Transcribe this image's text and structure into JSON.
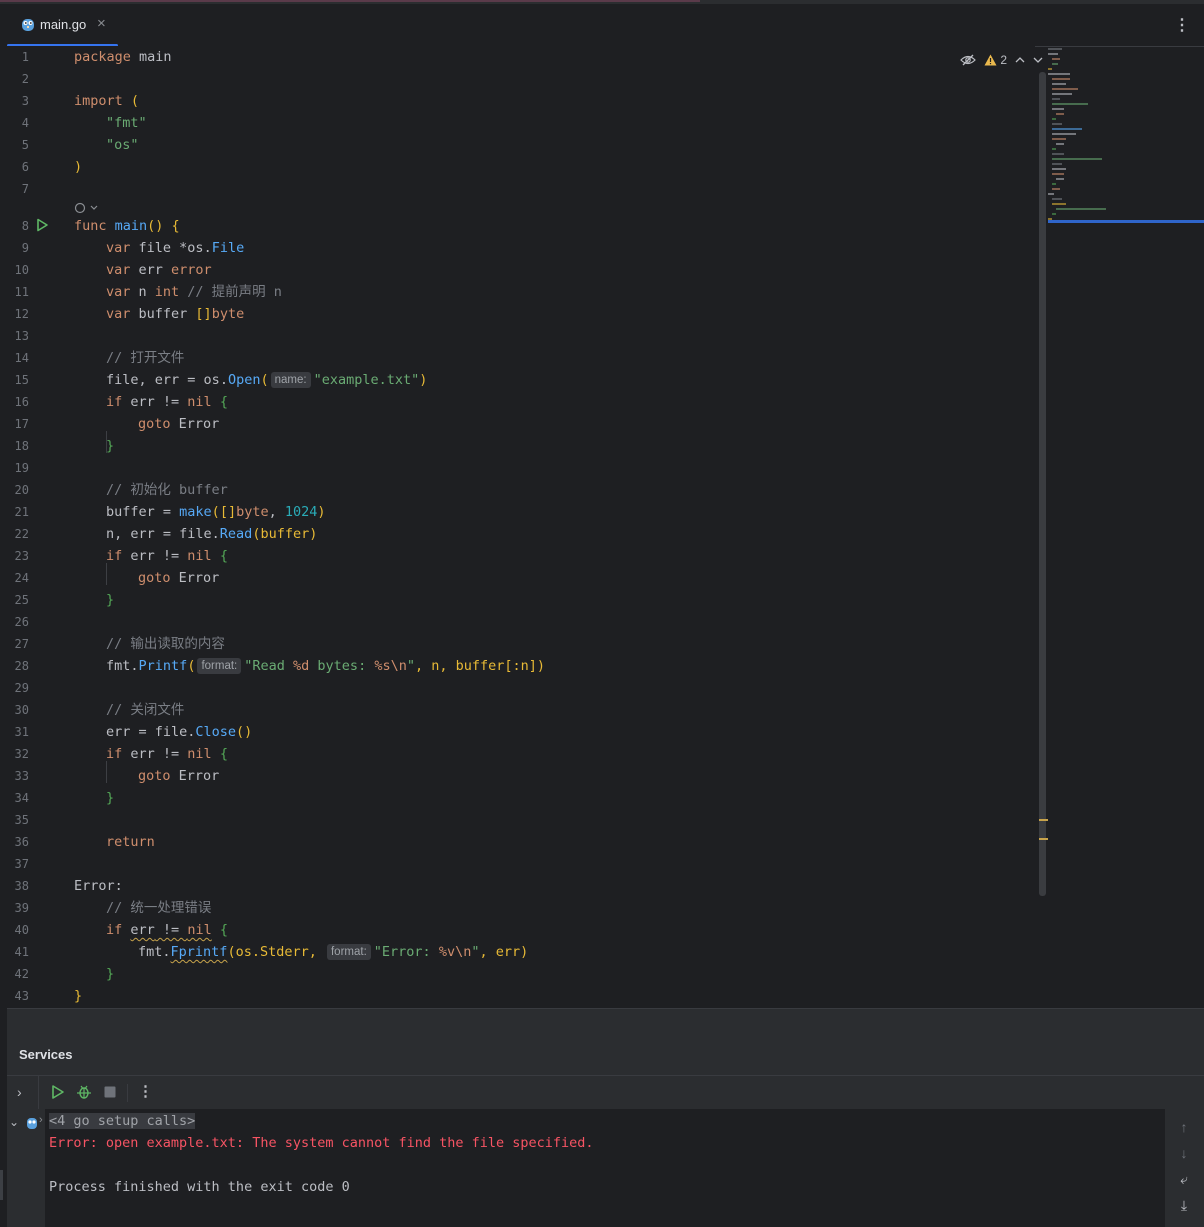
{
  "tab": {
    "file_name": "main.go",
    "close_glyph": "×",
    "menu_glyph": "⋮"
  },
  "inspections": {
    "warning_count": "2"
  },
  "gutter": {
    "line_numbers": [
      "1",
      "2",
      "3",
      "4",
      "5",
      "6",
      "7",
      "8",
      "9",
      "10",
      "11",
      "12",
      "13",
      "14",
      "15",
      "16",
      "17",
      "18",
      "19",
      "20",
      "21",
      "22",
      "23",
      "24",
      "25",
      "26",
      "27",
      "28",
      "29",
      "30",
      "31",
      "32",
      "33",
      "34",
      "35",
      "36",
      "37",
      "38",
      "39",
      "40",
      "41",
      "42",
      "43"
    ]
  },
  "code": {
    "l1_kw": "package",
    "l1_name": " main",
    "l3_kw": "import",
    "l3_paren": " (",
    "l4": "\"fmt\"",
    "l5": "\"os\"",
    "l6": ")",
    "l8_kw": "func",
    "l8_fn": " main",
    "l8_rest": "() {",
    "l9_kw": "var",
    "l9_rest": " file *",
    "l9_pkg": "os",
    "l9_type": "File",
    "l10_kw": "var",
    "l10_name": " err ",
    "l10_type": "error",
    "l11_kw": "var",
    "l11_name": " n ",
    "l11_type": "int",
    "l11_comment": " // 提前声明 n",
    "l12_kw": "var",
    "l12_name": " buffer ",
    "l12_br": "[]",
    "l12_type": "byte",
    "l14": "// 打开文件",
    "l15_a": "file, err = ",
    "l15_pkg": "os",
    "l15_dot": ".",
    "l15_fn": "Open",
    "l15_p": "(",
    "l15_hint": "name:",
    "l15_str": "\"example.txt\"",
    "l15_end": ")",
    "l16_kw": "if",
    "l16_mid": " err != ",
    "l16_nil": "nil",
    "l16_br": " {",
    "l17_kw": "goto",
    "l17_lbl": " Error",
    "l18": "}",
    "l20_cm": "// 初始化 buffer",
    "l21_a": "buffer = ",
    "l21_fn": "make",
    "l21_p": "(",
    "l21_br": "[]",
    "l21_ty": "byte",
    "l21_c": ", ",
    "l21_num": "1024",
    "l21_end": ")",
    "l22_a": "n, err = file.",
    "l22_fn": "Read",
    "l22_b": "(buffer)",
    "l23_kw": "if",
    "l23_mid": " err != ",
    "l23_nil": "nil",
    "l23_br": " {",
    "l24_kw": "goto",
    "l24_lbl": " Error",
    "l25": "}",
    "l27": "// 输出读取的内容",
    "l28_pkg": "fmt",
    "l28_dot": ".",
    "l28_fn": "Printf",
    "l28_p": "(",
    "l28_hint": "format:",
    "l28_str1": "\"Read ",
    "l28_fmt1": "%d",
    "l28_str2": " bytes: ",
    "l28_fmt2": "%s\\n",
    "l28_str3": "\"",
    "l28_rest": ", n, buffer[:n])",
    "l30": "// 关闭文件",
    "l31_a": "err = file.",
    "l31_fn": "Close",
    "l31_b": "()",
    "l32_kw": "if",
    "l32_mid": " err != ",
    "l32_nil": "nil",
    "l32_br": " {",
    "l33_kw": "goto",
    "l33_lbl": " Error",
    "l34": "}",
    "l36_kw": "return",
    "l38": "Error:",
    "l39": "// 统一处理错误",
    "l40_kw": "if",
    "l40_sp": " ",
    "l40_err": "err",
    "l40_mid": " != ",
    "l40_nil": "nil",
    "l40_br": " {",
    "l41_pkg": "fmt",
    "l41_dot": ".",
    "l41_fn": "Fprintf",
    "l41_p": "(os.Stderr, ",
    "l41_hint": "format:",
    "l41_str1": "\"Error: ",
    "l41_fmt": "%v\\n",
    "l41_str2": "\"",
    "l41_rest": ", err)",
    "l42": "}",
    "l43": "}"
  },
  "services": {
    "title": "Services",
    "console": {
      "collapsed_calls": "<4 go setup calls>",
      "error_line": "Error: open example.txt: The system cannot find the file specified.",
      "exit_line": "Process finished with the exit code 0"
    }
  },
  "colors": {
    "keyword": "#cf8e6d",
    "function": "#56a8f5",
    "string": "#6aab73",
    "number": "#2aacb8",
    "comment": "#7a7e85",
    "error": "#f75464",
    "accent": "#3574f0",
    "background": "#1e1f22"
  }
}
